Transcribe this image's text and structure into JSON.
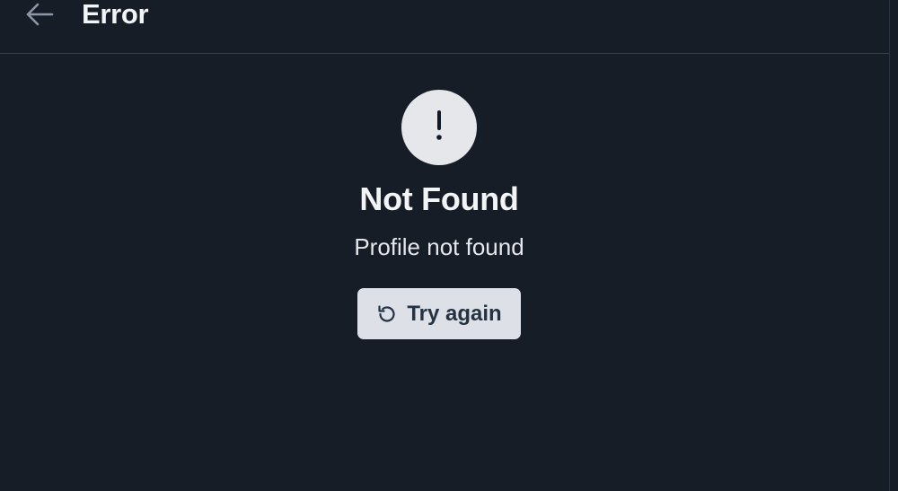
{
  "header": {
    "back_icon": "arrow-left-icon",
    "title": "Error"
  },
  "error": {
    "icon": "exclamation-icon",
    "title": "Not Found",
    "message": "Profile not found"
  },
  "retry_button": {
    "icon": "refresh-icon",
    "label": "Try again"
  },
  "colors": {
    "background": "#171d27",
    "divider": "#334152",
    "heading_text": "#f3f4f6",
    "icon_circle": "#e5e7eb",
    "button_background": "#dde1e7",
    "button_text": "#253243",
    "back_arrow": "#8b96a6"
  }
}
